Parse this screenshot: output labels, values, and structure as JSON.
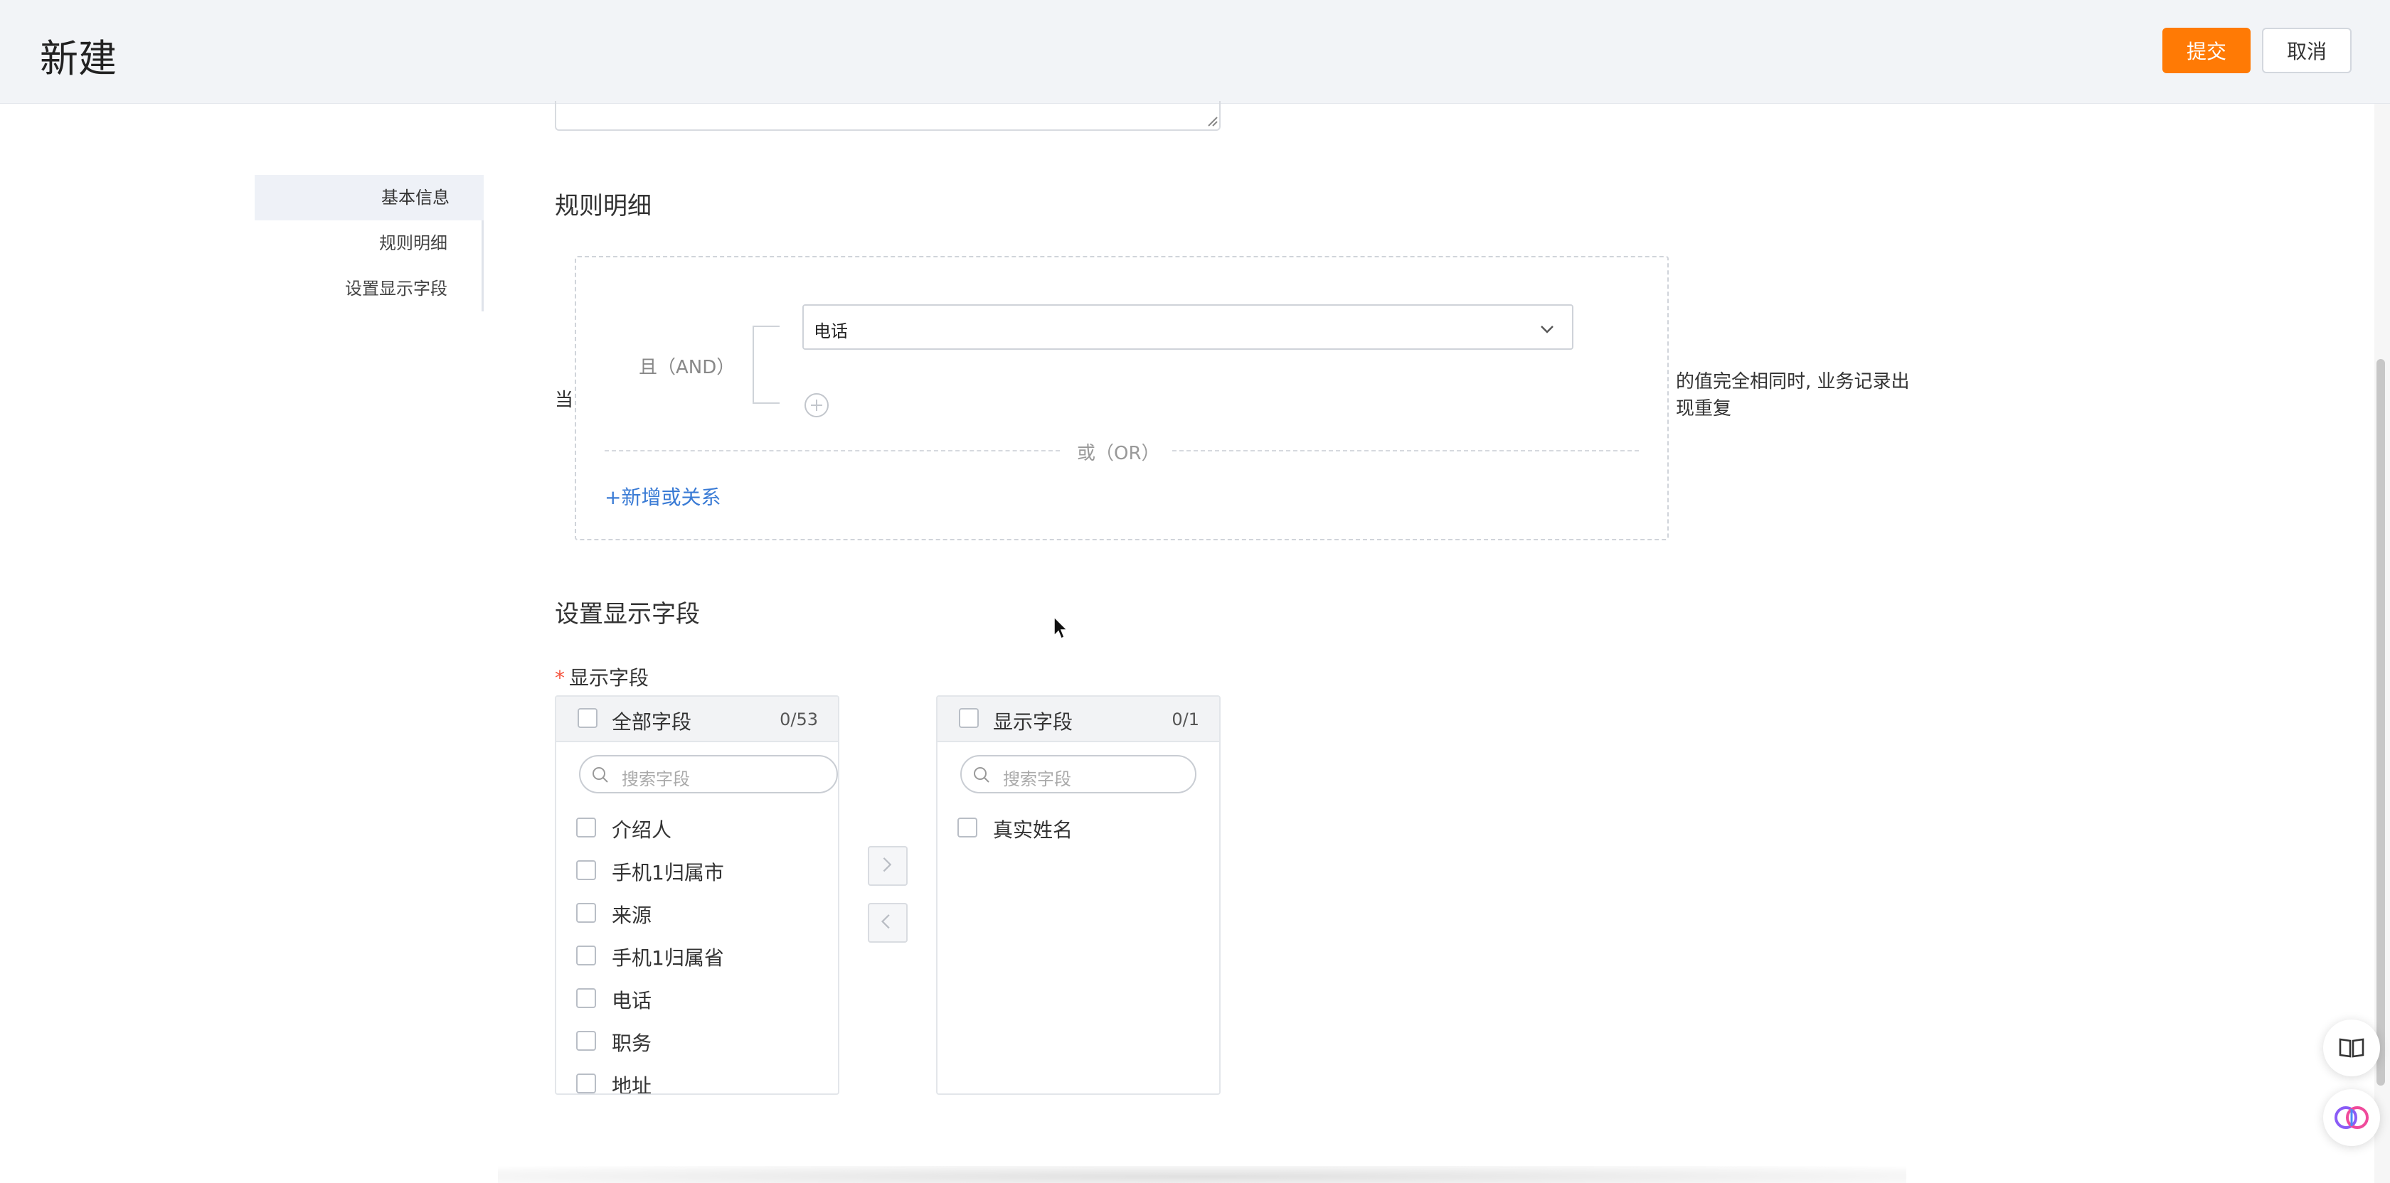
{
  "header": {
    "title": "新建",
    "submit_label": "提交",
    "cancel_label": "取消"
  },
  "side_nav": {
    "items": [
      {
        "label": "基本信息",
        "active": true
      },
      {
        "label": "规则明细",
        "active": false
      },
      {
        "label": "设置显示字段",
        "active": false
      }
    ]
  },
  "rule_section": {
    "title": "规则明细",
    "when_label": "当",
    "and_label": "且（AND）",
    "field_value": "电话",
    "or_label": "或（OR）",
    "add_or_label": "+新增或关系",
    "note": "的值完全相同时, 业务记录出现重复"
  },
  "display_section": {
    "title": "设置显示字段",
    "field_label": "显示字段",
    "left_panel": {
      "title": "全部字段",
      "count": "0/53",
      "search_placeholder": "搜索字段",
      "items": [
        "介绍人",
        "手机1归属市",
        "来源",
        "手机1归属省",
        "电话",
        "职务",
        "地址"
      ]
    },
    "right_panel": {
      "title": "显示字段",
      "count": "0/1",
      "search_placeholder": "搜索字段",
      "items": [
        "真实姓名"
      ]
    }
  },
  "colors": {
    "accent": "#ff7a05",
    "link": "#3a7bd5",
    "required": "#f5533d"
  },
  "icons": [
    "chevron-down-icon",
    "plus-circle-icon",
    "search-icon",
    "chevron-right-icon",
    "chevron-left-icon",
    "book-icon",
    "brain-icon",
    "cursor-icon"
  ]
}
